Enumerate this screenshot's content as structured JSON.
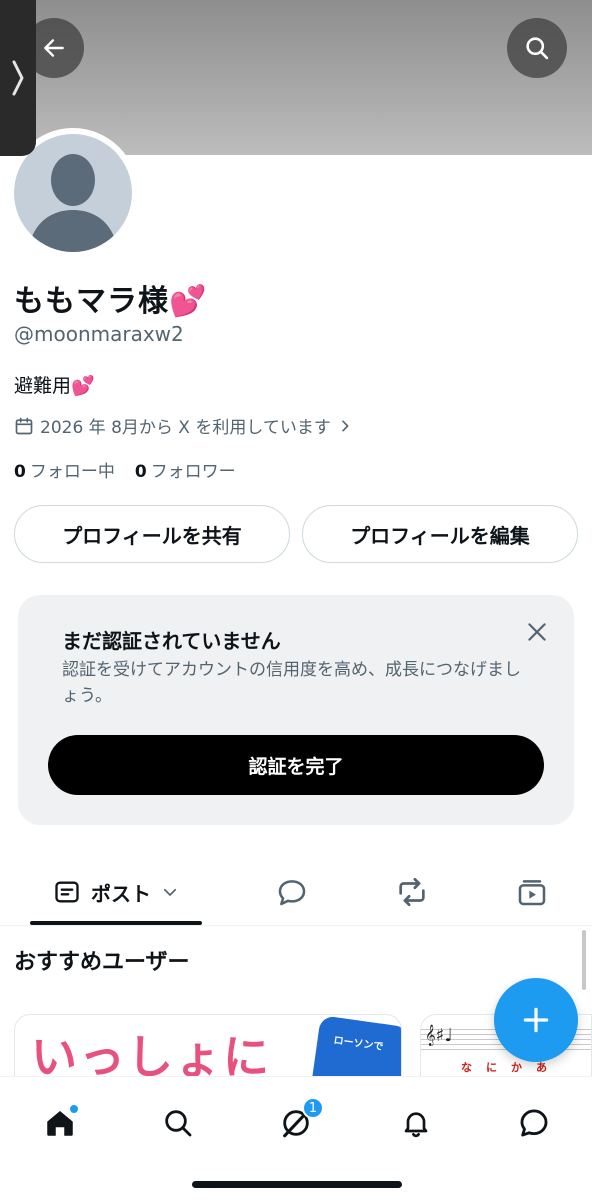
{
  "profile": {
    "display_name": "ももマラ様💕",
    "handle": "@moonmaraxw2",
    "bio": "避難用💕",
    "joined": "2026 年 8月から X を利用しています",
    "following_count": "0",
    "following_label": "フォロー中",
    "followers_count": "0",
    "followers_label": "フォロワー"
  },
  "actions": {
    "share_label": "プロフィールを共有",
    "edit_label": "プロフィールを編集"
  },
  "verify": {
    "title": "まだ認証されていません",
    "description": "認証を受けてアカウントの信用度を高め、成長につなげましょう。",
    "button_label": "認証を完了"
  },
  "tabs": {
    "posts_label": "ポスト"
  },
  "recommendations": {
    "title": "おすすめユーザー",
    "card1_text": "いっしょに",
    "card1_sign": "ローソンで",
    "card2_lyric": "なにかあ"
  },
  "nav": {
    "notification_badge": "1"
  },
  "colors": {
    "accent": "#1d9bf0",
    "text_primary": "#0f1419",
    "text_secondary": "#536471"
  },
  "icons": [
    "side-handle-chevron-icon",
    "back-arrow-icon",
    "search-icon",
    "calendar-icon",
    "chevron-right-icon",
    "close-icon",
    "posts-icon",
    "chevron-down-icon",
    "reply-icon",
    "repost-icon",
    "media-icon",
    "plus-icon",
    "home-icon",
    "grok-icon",
    "bell-icon",
    "messages-icon"
  ]
}
